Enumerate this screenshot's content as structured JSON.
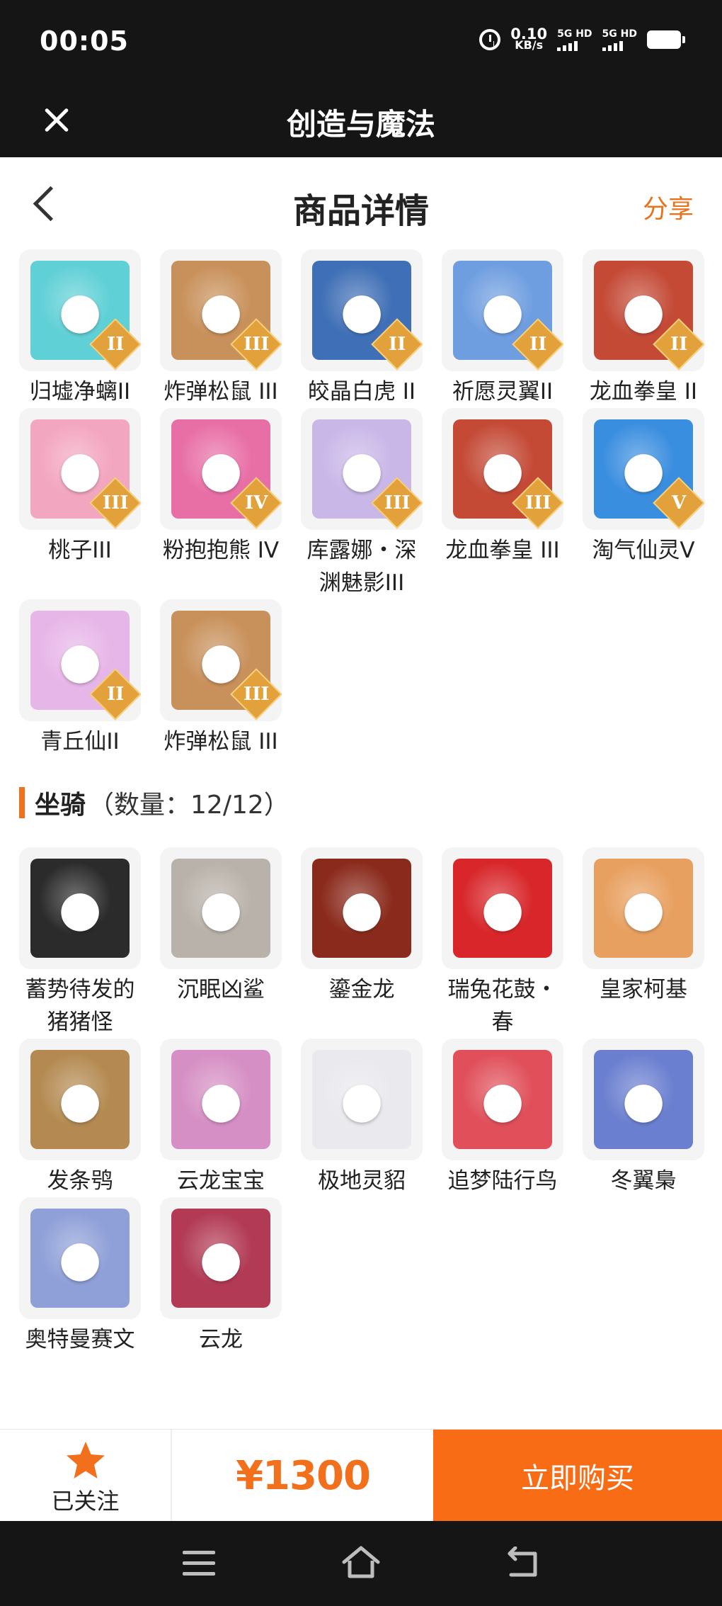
{
  "statusbar": {
    "time": "00:05",
    "net_speed_value": "0.10",
    "net_speed_unit": "KB/s",
    "sim1": "5G HD",
    "sim2": "5G HD"
  },
  "titlebar": {
    "title": "创造与魔法"
  },
  "header": {
    "title": "商品详情",
    "share": "分享"
  },
  "pets": [
    {
      "name": "归墟净螭II",
      "tier": "II",
      "color": "#5fd0d6",
      "icon": "dragon-icon"
    },
    {
      "name": "炸弹松鼠 III",
      "tier": "III",
      "color": "#c8905a",
      "icon": "squirrel-icon"
    },
    {
      "name": "皎晶白虎 II",
      "tier": "II",
      "color": "#3f6fb6",
      "icon": "tiger-icon"
    },
    {
      "name": "祈愿灵翼II",
      "tier": "II",
      "color": "#6f9ee0",
      "icon": "bird-icon"
    },
    {
      "name": "龙血拳皇 II",
      "tier": "II",
      "color": "#c44a36",
      "icon": "ram-icon"
    },
    {
      "name": "桃子III",
      "tier": "III",
      "color": "#f3a6c0",
      "icon": "cat-icon"
    },
    {
      "name": "粉抱抱熊 IV",
      "tier": "IV",
      "color": "#e86fa6",
      "icon": "bear-icon"
    },
    {
      "name": "库露娜・深渊魅影III",
      "tier": "III",
      "color": "#c9b7e8",
      "icon": "fairy-icon"
    },
    {
      "name": "龙血拳皇 III",
      "tier": "III",
      "color": "#c44a36",
      "icon": "ram-icon"
    },
    {
      "name": "淘气仙灵V",
      "tier": "V",
      "color": "#3a8ee0",
      "icon": "dog-icon"
    },
    {
      "name": "青丘仙II",
      "tier": "II",
      "color": "#e7b6e8",
      "icon": "fox-girl-icon"
    },
    {
      "name": "炸弹松鼠 III",
      "tier": "III",
      "color": "#c8905a",
      "icon": "squirrel-icon"
    }
  ],
  "mounts_section": {
    "name": "坐骑",
    "count": "（数量：12/12）"
  },
  "mounts": [
    {
      "name": "蓄势待发的猪猪怪",
      "color": "#2b2b2b",
      "icon": "pig-icon"
    },
    {
      "name": "沉眠凶鲨",
      "color": "#b9b2aa",
      "icon": "shark-icon"
    },
    {
      "name": "鎏金龙",
      "color": "#8a2a1c",
      "icon": "dragon-icon"
    },
    {
      "name": "瑞兔花鼓・春",
      "color": "#d8262a",
      "icon": "drum-icon"
    },
    {
      "name": "皇家柯基",
      "color": "#e8a060",
      "icon": "corgi-icon"
    },
    {
      "name": "发条鸮",
      "color": "#b48a52",
      "icon": "owl-icon"
    },
    {
      "name": "云龙宝宝",
      "color": "#d68fc4",
      "icon": "dragon-icon"
    },
    {
      "name": "极地灵貂",
      "color": "#e9e9ee",
      "icon": "ferret-icon"
    },
    {
      "name": "追梦陆行鸟",
      "color": "#e04f5a",
      "icon": "bird-icon"
    },
    {
      "name": "冬翼梟",
      "color": "#6b7fd0",
      "icon": "owl-icon"
    },
    {
      "name": "奥特曼赛文",
      "color": "#8fa0d8",
      "icon": "hero-icon"
    },
    {
      "name": "云龙",
      "color": "#b23a55",
      "icon": "dragon-icon"
    }
  ],
  "bottom": {
    "follow": "已关注",
    "price": "¥1300",
    "buy": "立即购买"
  },
  "colors": {
    "accent": "#f86c15",
    "dark": "#151515"
  }
}
